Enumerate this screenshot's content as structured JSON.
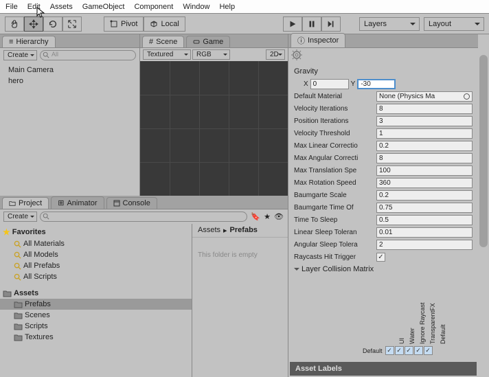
{
  "menu": {
    "file": "File",
    "edit": "Edit",
    "assets": "Assets",
    "gameobject": "GameObject",
    "component": "Component",
    "window": "Window",
    "help": "Help"
  },
  "toolbar": {
    "pivot": "Pivot",
    "local": "Local",
    "layers": "Layers",
    "layout": "Layout"
  },
  "hierarchy": {
    "tab": "Hierarchy",
    "create": "Create",
    "search_ph": "All",
    "items": [
      "Main Camera",
      "hero"
    ]
  },
  "scene": {
    "scene_tab": "Scene",
    "game_tab": "Game",
    "shading": "Textured",
    "rgb": "RGB",
    "twod": "2D"
  },
  "project": {
    "project_tab": "Project",
    "animator_tab": "Animator",
    "console_tab": "Console",
    "create": "Create",
    "favorites": "Favorites",
    "fav_items": [
      "All Materials",
      "All Models",
      "All Prefabs",
      "All Scripts"
    ],
    "assets": "Assets",
    "folders": [
      "Prefabs",
      "Scenes",
      "Scripts",
      "Textures"
    ],
    "breadcrumb": [
      "Assets",
      "Prefabs"
    ],
    "empty": "This folder is empty"
  },
  "inspector": {
    "tab": "Inspector",
    "gravity": "Gravity",
    "x": "X",
    "y": "Y",
    "x_val": "0",
    "y_val": "-30",
    "props": [
      {
        "label": "Default Material",
        "type": "obj",
        "value": "None (Physics Ma"
      },
      {
        "label": "Velocity Iterations",
        "value": "8"
      },
      {
        "label": "Position Iterations",
        "value": "3"
      },
      {
        "label": "Velocity Threshold",
        "value": "1"
      },
      {
        "label": "Max Linear Correctio",
        "value": "0.2"
      },
      {
        "label": "Max Angular Correcti",
        "value": "8"
      },
      {
        "label": "Max Translation Spe",
        "value": "100"
      },
      {
        "label": "Max Rotation Speed",
        "value": "360"
      },
      {
        "label": "Baumgarte Scale",
        "value": "0.2"
      },
      {
        "label": "Baumgarte Time Of",
        "value": "0.75"
      },
      {
        "label": "Time To Sleep",
        "value": "0.5"
      },
      {
        "label": "Linear Sleep Toleran",
        "value": "0.01"
      },
      {
        "label": "Angular Sleep Tolera",
        "value": "2"
      },
      {
        "label": "Raycasts Hit Trigger",
        "type": "check",
        "value": true
      }
    ],
    "matrix_hdr": "Layer Collision Matrix",
    "matrix_labels": [
      "Default",
      "TransparentFX",
      "Ignore Raycast",
      "Water",
      "UI"
    ],
    "matrix_row": "Default",
    "asset_labels": "Asset Labels"
  }
}
